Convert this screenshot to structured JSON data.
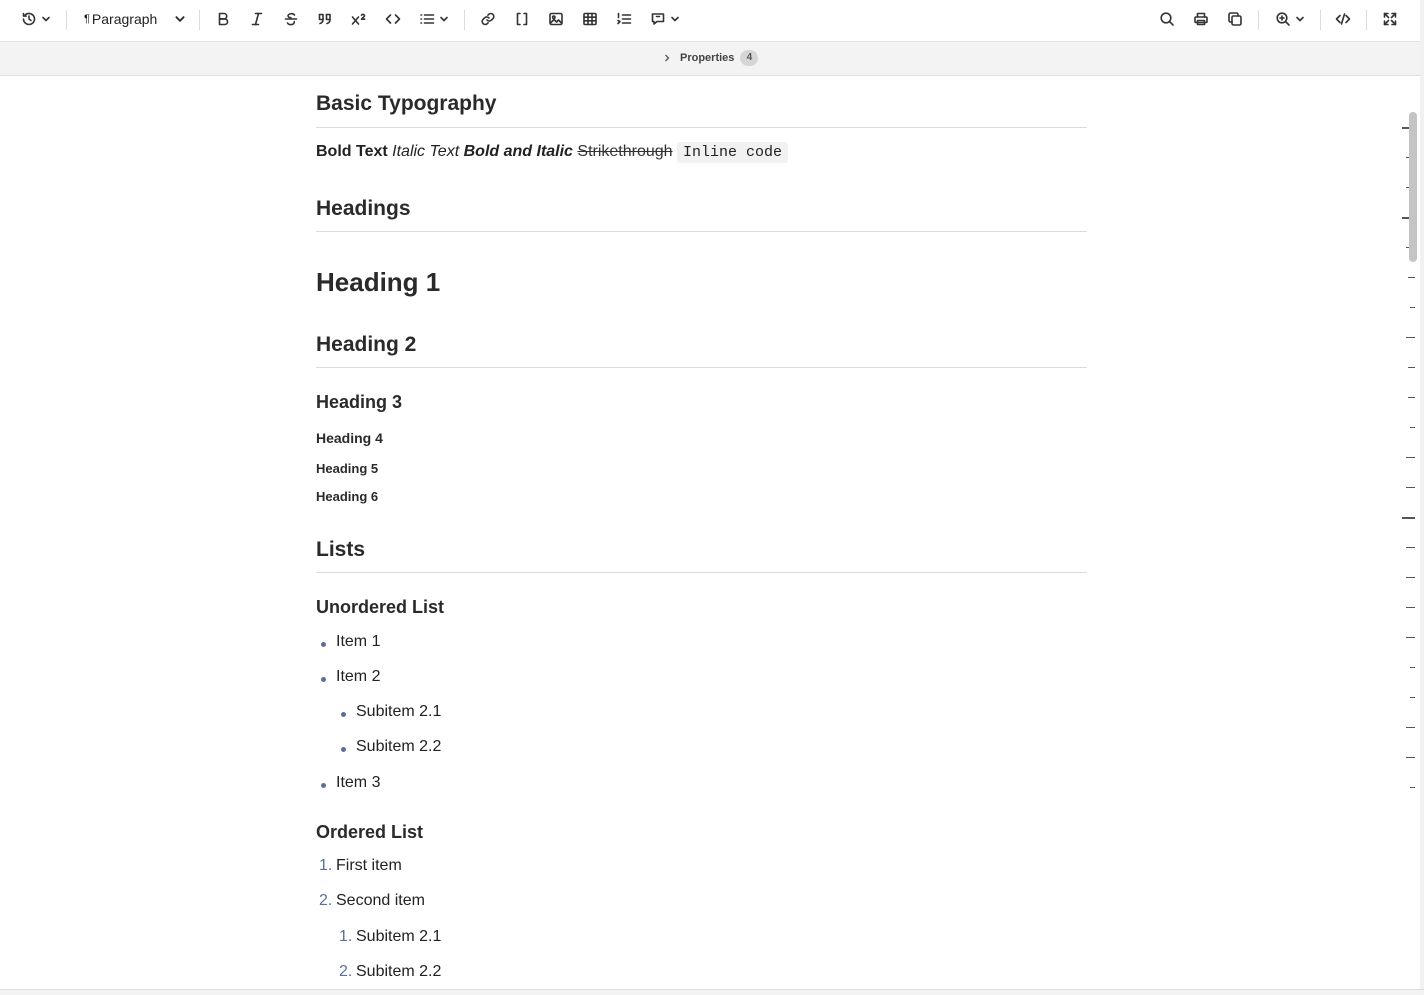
{
  "toolbar": {
    "paragraph_label": "Paragraph",
    "paragraph_mark": "¶"
  },
  "properties": {
    "label": "Properties",
    "count": "4"
  },
  "doc": {
    "basic_typography": "Basic Typography",
    "bold": "Bold Text",
    "italic": "Italic Text",
    "bold_italic": "Bold and Italic",
    "strike": "Strikethrough",
    "code": "Inline code",
    "headings": "Headings",
    "h1": "Heading 1",
    "h2": "Heading 2",
    "h3": "Heading 3",
    "h4": "Heading 4",
    "h5": "Heading 5",
    "h6": "Heading 6",
    "lists": "Lists",
    "unordered_title": "Unordered List",
    "ul_items": [
      "Item 1",
      "Item 2",
      "Subitem 2.1",
      "Subitem 2.2",
      "Item 3"
    ],
    "ordered_title": "Ordered List",
    "ol_items": [
      "First item",
      "Second item",
      "Subitem 2.1",
      "Subitem 2.2"
    ],
    "ol_numbers": [
      "1.",
      "2.",
      "1.",
      "2."
    ]
  }
}
